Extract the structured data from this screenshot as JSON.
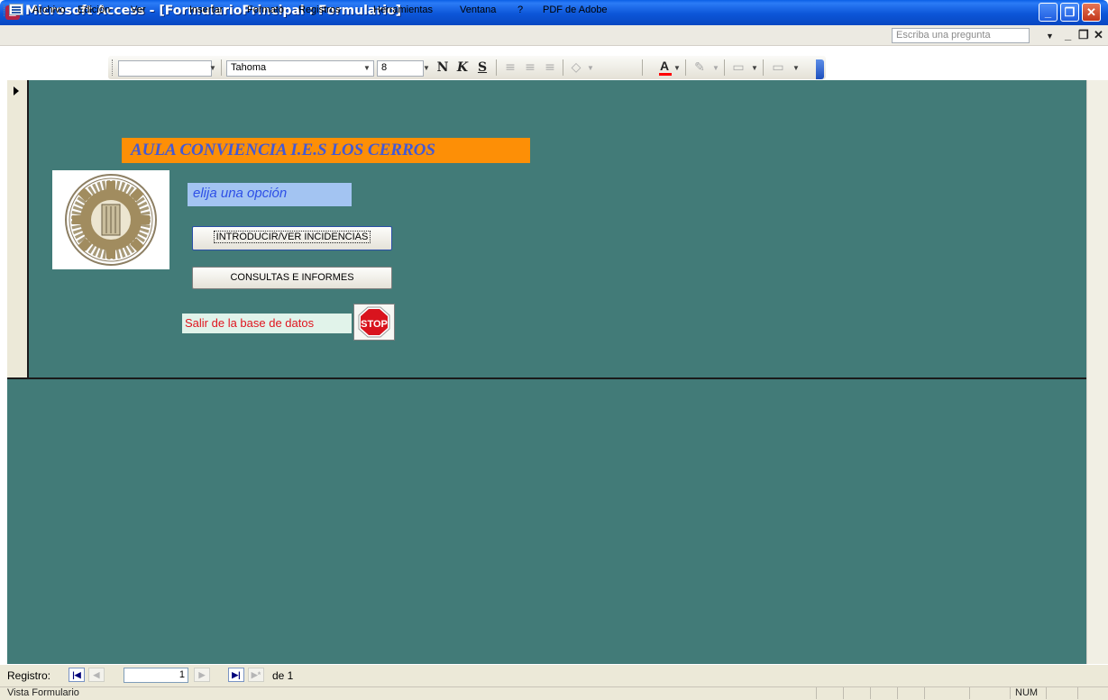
{
  "window": {
    "title": "Microsoft Access - [FormularioPrincipal : Formulario]",
    "controls": [
      "minimize-icon",
      "restore-icon",
      "close-icon"
    ]
  },
  "menu": {
    "items": [
      "Archivo",
      "Edición",
      "Ver",
      "Insertar",
      "Formato",
      "Registros",
      "Herramientas",
      "Ventana",
      "?",
      "PDF de Adobe"
    ],
    "help_placeholder": "Escriba una pregunta"
  },
  "toolbar": {
    "object_combo": "",
    "font_name": "Tahoma",
    "font_size": "8",
    "bold": "N",
    "italic": "K",
    "underline": "S",
    "font_color_icon": "A",
    "font_color": "#ff0000"
  },
  "form": {
    "title": "AULA CONVIENCIA  I.E.S LOS CERROS",
    "choose_label": "elija una opción",
    "button_incidencias": "INTRODUCIR/VER INCIDENCIAS",
    "button_consultas": "CONSULTAS E INFORMES",
    "exit_label": "Salir de la base de datos",
    "stop_text": "STOP",
    "logo": "school-seal-logo",
    "background_color": "#427b78",
    "title_background": "#fd8f06"
  },
  "navigation": {
    "label": "Registro:",
    "current": "1",
    "of_label": "de 1"
  },
  "status": {
    "text": "Vista Formulario",
    "num": "NUM"
  }
}
